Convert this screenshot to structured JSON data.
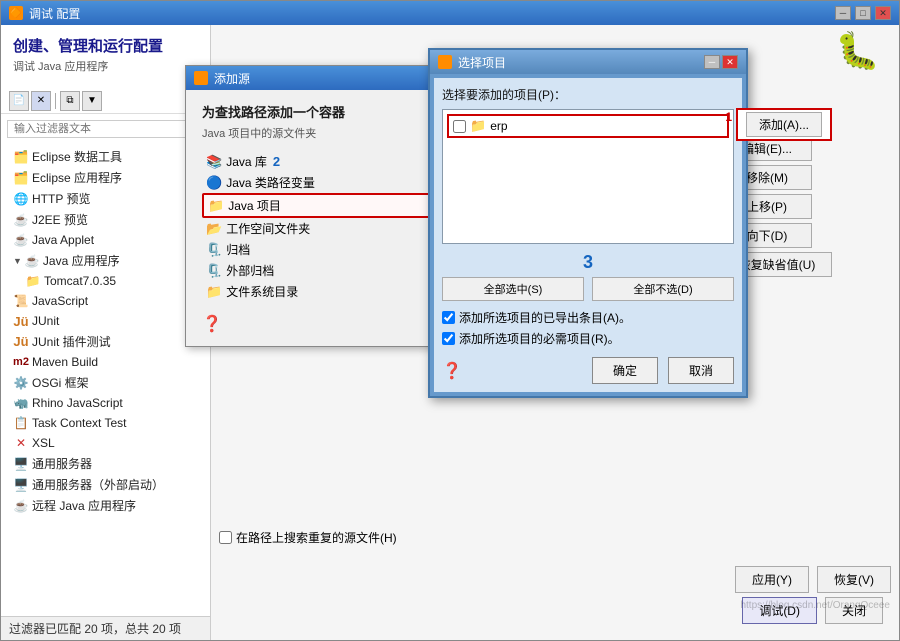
{
  "mainWindow": {
    "title": "调试 配置",
    "titleIcon": "🔶",
    "leftTitle": "创建、管理和运行配置",
    "leftSubtitle": "调试 Java 应用程序",
    "filterPlaceholder": "输入过滤器文本",
    "statusBar": "过滤器已匹配 20 项，总共 20 项"
  },
  "treeItems": [
    {
      "id": "eclipse-data",
      "label": "Eclipse 数据工具",
      "icon": "eclipse",
      "indent": 1
    },
    {
      "id": "eclipse-app",
      "label": "Eclipse 应用程序",
      "icon": "eclipse",
      "indent": 1
    },
    {
      "id": "http-preview",
      "label": "HTTP 预览",
      "icon": "http",
      "indent": 1
    },
    {
      "id": "j2ee",
      "label": "J2EE 预览",
      "icon": "eclipse",
      "indent": 1
    },
    {
      "id": "java-applet",
      "label": "Java Applet",
      "icon": "java",
      "indent": 1
    },
    {
      "id": "java-app",
      "label": "Java 应用程序",
      "icon": "java",
      "indent": 1,
      "expanded": true
    },
    {
      "id": "tomcat",
      "label": "Tomcat7.0.35",
      "icon": "folder",
      "indent": 2
    },
    {
      "id": "javascript",
      "label": "JavaScript",
      "icon": "js",
      "indent": 1
    },
    {
      "id": "junit",
      "label": "JUnit",
      "icon": "junit",
      "indent": 1
    },
    {
      "id": "junit-plugin",
      "label": "JUnit 插件测试",
      "icon": "junit",
      "indent": 1
    },
    {
      "id": "maven",
      "label": "Maven Build",
      "icon": "maven",
      "indent": 1
    },
    {
      "id": "osgi",
      "label": "OSGi 框架",
      "icon": "osgi",
      "indent": 1
    },
    {
      "id": "rhino",
      "label": "Rhino JavaScript",
      "icon": "rhino",
      "indent": 1
    },
    {
      "id": "task-context",
      "label": "Task Context Test",
      "icon": "task",
      "indent": 1
    },
    {
      "id": "xsl",
      "label": "XSL",
      "icon": "xsl",
      "indent": 1
    },
    {
      "id": "general-server",
      "label": "通用服务器",
      "icon": "server",
      "indent": 1
    },
    {
      "id": "general-server-ext",
      "label": "通用服务器（外部启动）",
      "icon": "server",
      "indent": 1
    },
    {
      "id": "remote-java",
      "label": "远程 Java 应用程序",
      "icon": "remote",
      "indent": 1
    }
  ],
  "addSourceDialog": {
    "title": "添加源",
    "sectionTitle": "为查找路径添加一个容器",
    "desc": "Java 项目中的源文件夹",
    "sources": [
      {
        "id": "java-lib",
        "label": "Java 库",
        "icon": "java-lib"
      },
      {
        "id": "java-classpath",
        "label": "Java 类路径变量",
        "icon": "java-cp"
      },
      {
        "id": "java-project",
        "label": "Java 项目",
        "icon": "java-proj",
        "highlighted": true
      },
      {
        "id": "workspace-folder",
        "label": "工作空间文件夹",
        "icon": "ws-folder"
      },
      {
        "id": "archive",
        "label": "归档",
        "icon": "archive"
      },
      {
        "id": "external-archive",
        "label": "外部归档",
        "icon": "ext-archive"
      },
      {
        "id": "filesystem-dir",
        "label": "文件系统目录",
        "icon": "fs-dir"
      }
    ],
    "numLabel": "2"
  },
  "selectDialog": {
    "title": "选择项目",
    "label": "选择要添加的项目(P)：",
    "items": [
      {
        "id": "erp",
        "label": "erp",
        "checked": false,
        "highlighted": true
      }
    ],
    "btnSelectAll": "全部选中(S)",
    "btnDeselectAll": "全部不选(D)",
    "checkAddRequired": "添加所选项目的已导出条目(A)。",
    "checkAddNecessary": "添加所选项目的必需项目(R)。",
    "btnConfirm": "确定",
    "btnCancel": "取消",
    "numLabel": "3"
  },
  "rightPanel": {
    "btnAdd": "添加(A)...",
    "btnEdit": "编辑(E)...",
    "btnRemove": "移除(M)",
    "btnMoveUp": "上移(P)",
    "btnMoveDown": "向下(D)",
    "btnRestore": "恢复缺省值(U)",
    "checkSearchDuplicate": "在路径上搜索重复的源文件(H)",
    "btnApply": "应用(Y)",
    "btnRestore2": "恢复(V)",
    "btnDebug": "调试(D)",
    "btnClose": "关闭"
  },
  "numLabel1": "1"
}
